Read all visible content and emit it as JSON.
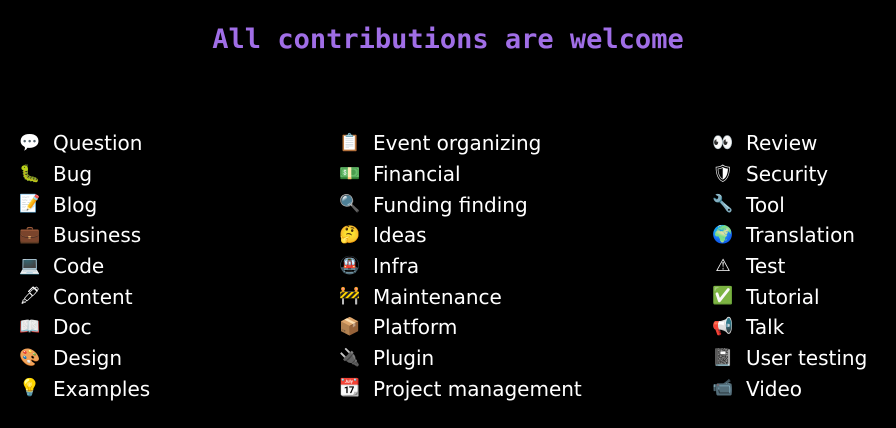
{
  "title": "All contributions are welcome",
  "columns": [
    {
      "items": [
        {
          "icon": "speech-bubble-icon",
          "emoji": "💬",
          "label": "Question"
        },
        {
          "icon": "bug-icon",
          "emoji": "🐛",
          "label": "Bug"
        },
        {
          "icon": "memo-icon",
          "emoji": "📝",
          "label": "Blog"
        },
        {
          "icon": "briefcase-icon",
          "emoji": "💼",
          "label": "Business"
        },
        {
          "icon": "laptop-icon",
          "emoji": "💻",
          "label": "Code"
        },
        {
          "icon": "fountain-pen-icon",
          "emoji": "🖋",
          "label": "Content"
        },
        {
          "icon": "open-book-icon",
          "emoji": "📖",
          "label": "Doc"
        },
        {
          "icon": "palette-icon",
          "emoji": "🎨",
          "label": "Design"
        },
        {
          "icon": "light-bulb-icon",
          "emoji": "💡",
          "label": "Examples"
        }
      ]
    },
    {
      "items": [
        {
          "icon": "clipboard-icon",
          "emoji": "📋",
          "label": "Event organizing"
        },
        {
          "icon": "money-icon",
          "emoji": "💵",
          "label": "Financial"
        },
        {
          "icon": "magnifier-icon",
          "emoji": "🔍",
          "label": "Funding finding"
        },
        {
          "icon": "thinking-face-icon",
          "emoji": "🤔",
          "label": "Ideas"
        },
        {
          "icon": "metro-icon",
          "emoji": "🚇",
          "label": "Infra"
        },
        {
          "icon": "construction-icon",
          "emoji": "🚧",
          "label": "Maintenance"
        },
        {
          "icon": "package-icon",
          "emoji": "📦",
          "label": "Platform"
        },
        {
          "icon": "plug-icon",
          "emoji": "🔌",
          "label": "Plugin"
        },
        {
          "icon": "calendar-icon",
          "emoji": "📆",
          "label": "Project management"
        }
      ]
    },
    {
      "items": [
        {
          "icon": "eyes-icon",
          "emoji": "👀",
          "label": "Review"
        },
        {
          "icon": "shield-icon",
          "emoji": "🛡",
          "label": "Security"
        },
        {
          "icon": "wrench-icon",
          "emoji": "🔧",
          "label": "Tool"
        },
        {
          "icon": "globe-icon",
          "emoji": "🌍",
          "label": "Translation"
        },
        {
          "icon": "warning-icon",
          "emoji": "⚠",
          "label": "Test"
        },
        {
          "icon": "check-mark-icon",
          "emoji": "✅",
          "label": "Tutorial"
        },
        {
          "icon": "megaphone-icon",
          "emoji": "📢",
          "label": "Talk"
        },
        {
          "icon": "notebook-icon",
          "emoji": "📓",
          "label": "User testing"
        },
        {
          "icon": "video-camera-icon",
          "emoji": "📹",
          "label": "Video"
        }
      ]
    }
  ]
}
